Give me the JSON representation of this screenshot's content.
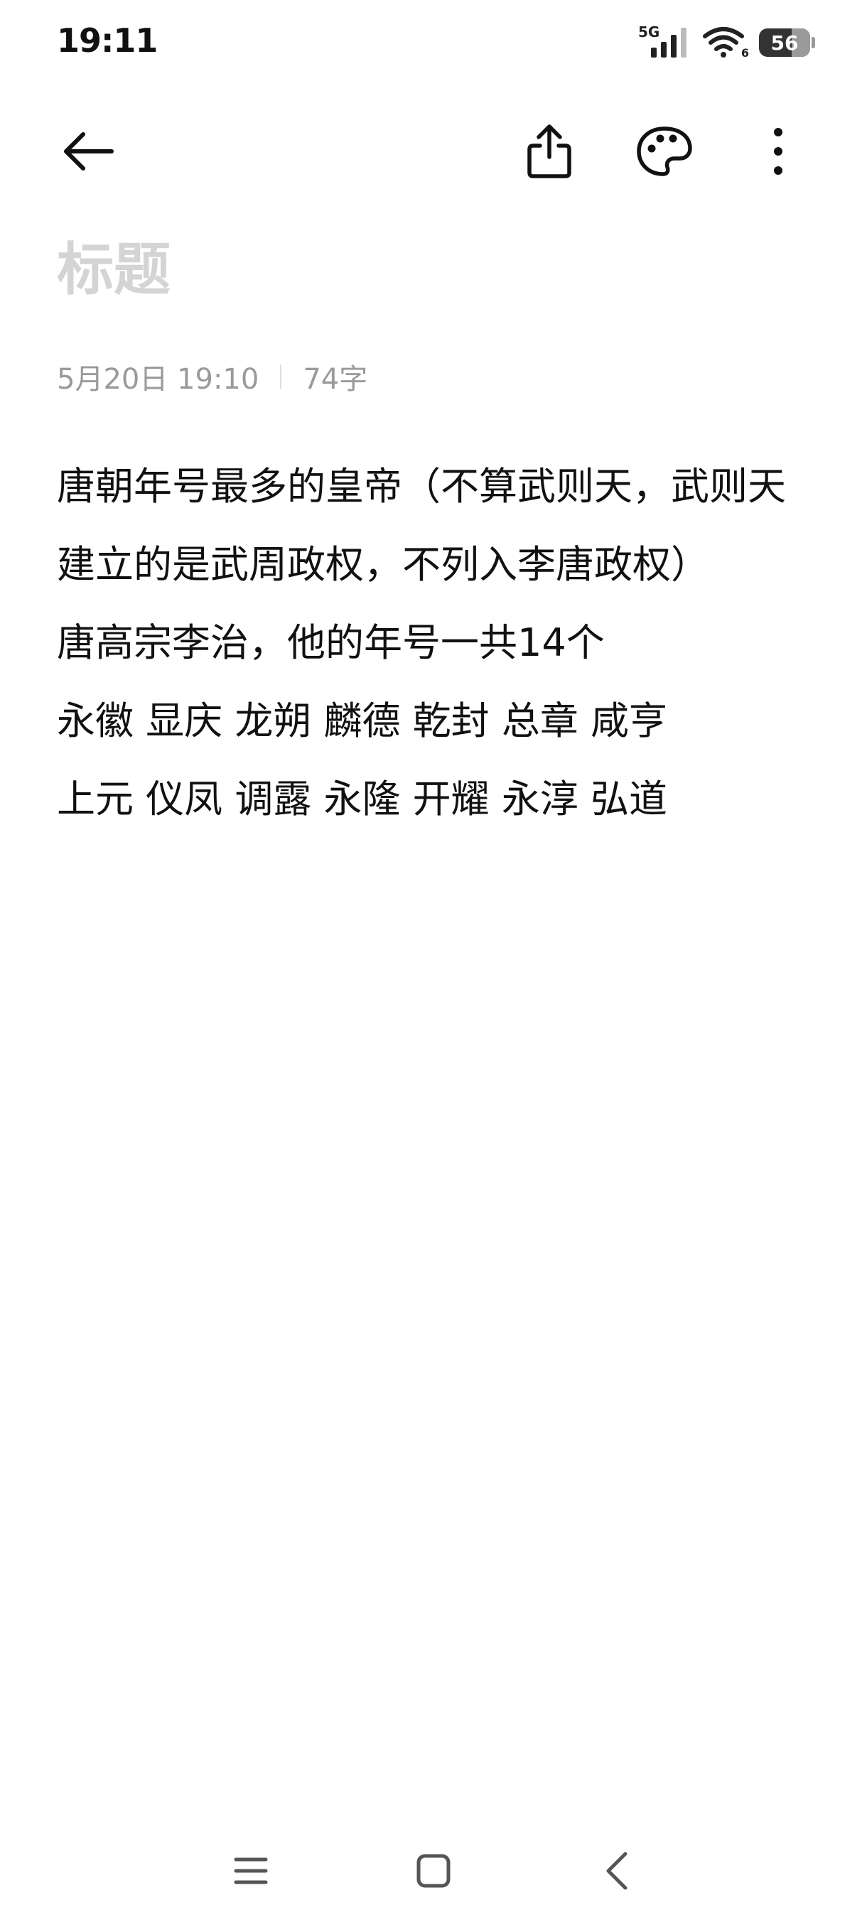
{
  "status_bar": {
    "time": "19:11",
    "network": "5G",
    "wifi_badge": "6",
    "battery": "56",
    "icons": [
      "signal-icon",
      "wifi-icon",
      "battery-icon"
    ]
  },
  "toolbar": {
    "icons": [
      "back-arrow-icon",
      "share-icon",
      "palette-icon",
      "more-vertical-icon"
    ]
  },
  "note": {
    "title_placeholder": "标题",
    "date": "5月20日 19:10",
    "char_count": "74字",
    "body_lines": [
      "唐朝年号最多的皇帝（不算武则天，武则天建立的是武周政权，不列入李唐政权）",
      "唐高宗李治，他的年号一共14个",
      "永徽 显庆 龙朔 麟德 乾封 总章 咸亨",
      "上元 仪凤 调露 永隆 开耀 永淳 弘道"
    ]
  },
  "nav_bar": {
    "icons": [
      "menu-icon",
      "home-icon",
      "back-icon"
    ]
  },
  "colors": {
    "background": "#ffffff",
    "text": "#111111",
    "title_placeholder": "#d4d4d4",
    "meta": "#9a9a9a"
  }
}
